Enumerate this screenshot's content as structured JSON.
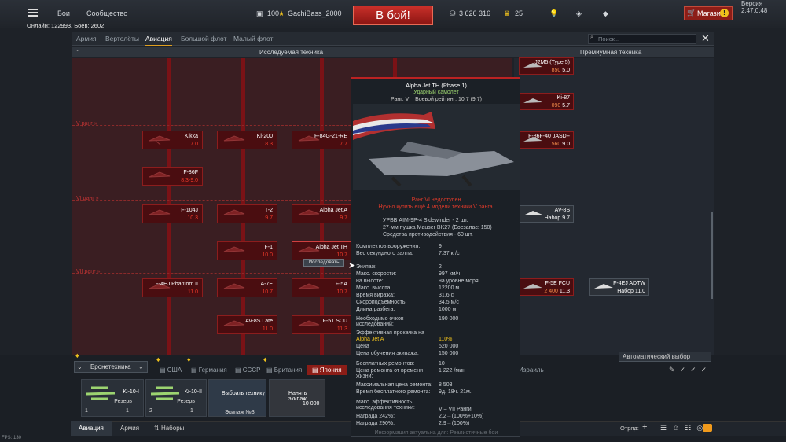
{
  "topbar": {
    "fights": "Бои",
    "community": "Сообщество",
    "rank_level": "100",
    "nickname": "GachiBass_2000",
    "fight_button": "В бой!",
    "silver_lions": "3 626 316",
    "golden_eagles": "25",
    "shop": "Магазин",
    "shop_badge": "!",
    "version": "Версия 2.47.0.48",
    "online": "Онлайн: 122993, Боёв: 2602"
  },
  "tabs": [
    "Армия",
    "Вертолёты",
    "Авиация",
    "Большой флот",
    "Малый флот"
  ],
  "search": {
    "placeholder": "Поиск..."
  },
  "tree": {
    "header_researched": "Исследуемая техника",
    "header_premium": "Премиумная техника",
    "rank_v": "V ранг »",
    "rank_vi": "VI ранг »",
    "rank_vii": "VII ранг »",
    "cards": [
      {
        "name": "Kikka",
        "br": "7.0"
      },
      {
        "name": "Ki-200",
        "br": "8.3"
      },
      {
        "name": "F-84G-21-RE",
        "br": "7.7"
      },
      {
        "name": "F-86F",
        "br": "8.3-9.0"
      },
      {
        "name": "F-104J",
        "br": "10.3"
      },
      {
        "name": "T-2",
        "br": "9.7"
      },
      {
        "name": "Alpha Jet A",
        "br": "9.7"
      },
      {
        "name": "F-1",
        "br": "10.0"
      },
      {
        "name": "Alpha Jet TH",
        "br": "10.7"
      },
      {
        "name": "F-4EJ Phantom II",
        "br": "11.0"
      },
      {
        "name": "A-7E",
        "br": "10.7"
      },
      {
        "name": "F-5A",
        "br": "10.7"
      },
      {
        "name": "AV-8S Late",
        "br": "11.0"
      },
      {
        "name": "F-5T SCU",
        "br": "11.3"
      }
    ],
    "research_btn": "Исследовать",
    "premium": [
      {
        "name": "J2M5 (Type 5)",
        "br": "5.0",
        "price": "850"
      },
      {
        "name": "Ki-87",
        "br": "5.7",
        "price": "090"
      },
      {
        "name": "F-86F-40 JASDF",
        "br": "9.0",
        "price": "560"
      },
      {
        "name": "AV-8S",
        "br": "Набор 9.7",
        "price": ""
      },
      {
        "name": "F-5E FCU",
        "br": "11.3",
        "price": "2 400"
      },
      {
        "name": "F-4EJ ADTW",
        "br": "Набор 11.0",
        "price": ""
      }
    ]
  },
  "tooltip": {
    "title": "Alpha Jet TH (Phase 1)",
    "role": "Ударный самолёт",
    "rank": "Ранг: VI",
    "br": "Боевой рейтинг: 10.7 (9.7)",
    "warn1": "Ранг VI недоступен",
    "warn2": "Нужно купить ещё 4 модели техники V ранга.",
    "weapons": [
      "УРВВ AIM-9P-4 Sidewinder - 2 шт.",
      "27-мм пушка Mauser BK27 (Боезапас: 150)",
      "Средства противодействия - 60 шт."
    ],
    "stats": [
      {
        "k": "Комплектов вооружения:",
        "v": "9"
      },
      {
        "k": "Вес секундного залпа:",
        "v": "7.37 кг/с"
      },
      {
        "k": "Экипаж",
        "v": "2"
      },
      {
        "k": "Макс. скорости:",
        "v": "997 км/ч"
      },
      {
        "k": "на высоте:",
        "v": "на уровне моря"
      },
      {
        "k": "Макс. высота:",
        "v": "12200 м"
      },
      {
        "k": "Время виража:",
        "v": "31.6 с"
      },
      {
        "k": "Скороподъёмность:",
        "v": "34.5 м/с"
      },
      {
        "k": "Длина разбега:",
        "v": "1000 м"
      }
    ],
    "research_need": "Необходимо очков исследований:",
    "research_val": "190 000",
    "boost_label": "Эффективная прокачка на",
    "boost_unit": "Alpha Jet A",
    "boost_val": "110%",
    "price_label": "Цена",
    "price_val": "520 000",
    "crew_label": "Цена обучения экипажа:",
    "crew_val": "150 000",
    "free_rep_label": "Бесплатных ремонтов:",
    "free_rep_val": "10",
    "rep_cost_label": "Цена ремонта от времени жизни:",
    "rep_cost_val": "1 222 /мин",
    "max_rep_label": "Максимальная цена ремонта:",
    "max_rep_val": "8 503",
    "free_time_label": "Время бесплатного ремонта:",
    "free_time_val": "9д. 18ч. 21м.",
    "eff_label": "Макс. эффективность исследования техники:",
    "eff_val": "V – VII Ранги",
    "rew1_label": "Награда 242%:",
    "rew1_val": "2.2→(100%+10%)",
    "rew2_label": "Награда 290%:",
    "rew2_val": "2.9→(100%)",
    "footer": "Информация актуальна для: Реалистичные бои"
  },
  "bottom": {
    "vehicles": "Бронетехника",
    "nations": [
      "США",
      "Германия",
      "СССР",
      "Британия",
      "Япония",
      "Израиль"
    ],
    "auto_select": "Автоматический выбор",
    "crews": [
      {
        "name": "Ki-10-I",
        "status": "Резерв",
        "n": "1",
        "m": "1"
      },
      {
        "name": "Ki-10-II",
        "status": "Резерв",
        "n": "2",
        "m": "1"
      }
    ],
    "choose": "Выбрать технику",
    "crew3": "Экипаж №3",
    "hire": "Нанять экипаж",
    "hire_cost": "10 000",
    "nav_aviation": "Авиация",
    "nav_army": "Армия",
    "nav_sets": "Наборы",
    "squad": "Отряд:",
    "fps": "FPS: 130"
  }
}
